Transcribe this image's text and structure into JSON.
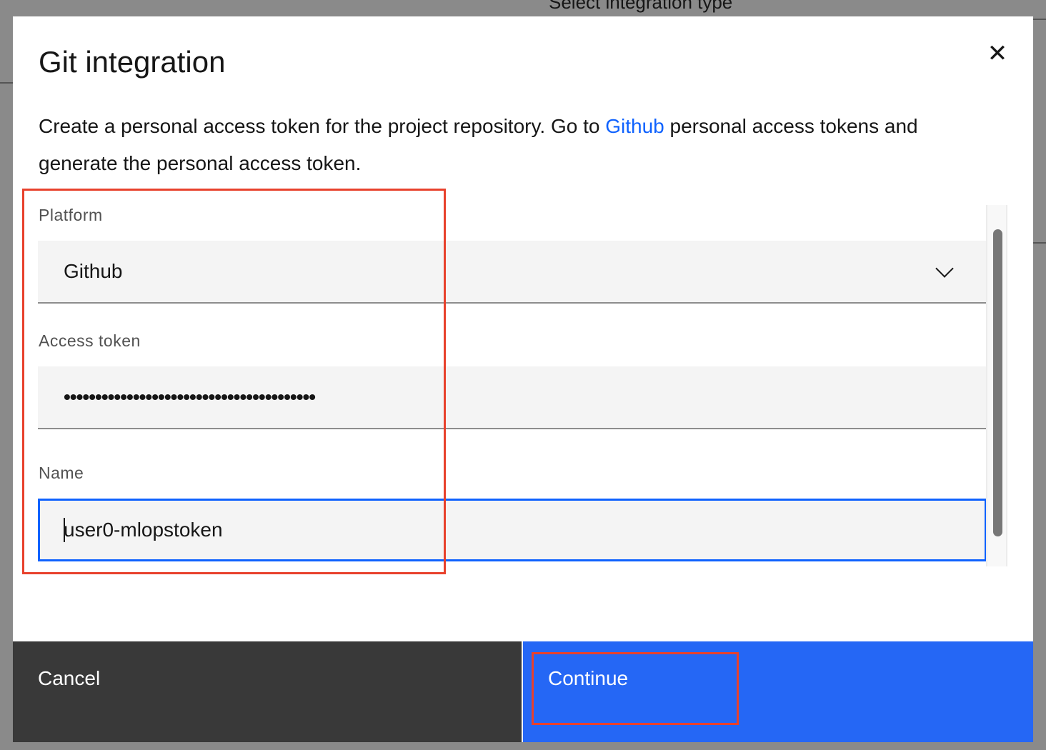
{
  "background": {
    "heading": "Select integration type"
  },
  "modal": {
    "title": "Git integration",
    "close_icon": "close-icon",
    "description_before": "Create a personal access token for the project repository. Go to ",
    "description_link": "Github",
    "description_after": " personal access tokens and generate the personal access token.",
    "platform": {
      "label": "Platform",
      "value": "Github"
    },
    "access_token": {
      "label": "Access token",
      "value": "••••••••••••••••••••••••••••••••••••••••"
    },
    "name": {
      "label": "Name",
      "value": "user0-mlopstoken"
    },
    "cancel_label": "Cancel",
    "continue_label": "Continue"
  },
  "colors": {
    "primary": "#0f62fe",
    "highlight": "#e8412c"
  }
}
